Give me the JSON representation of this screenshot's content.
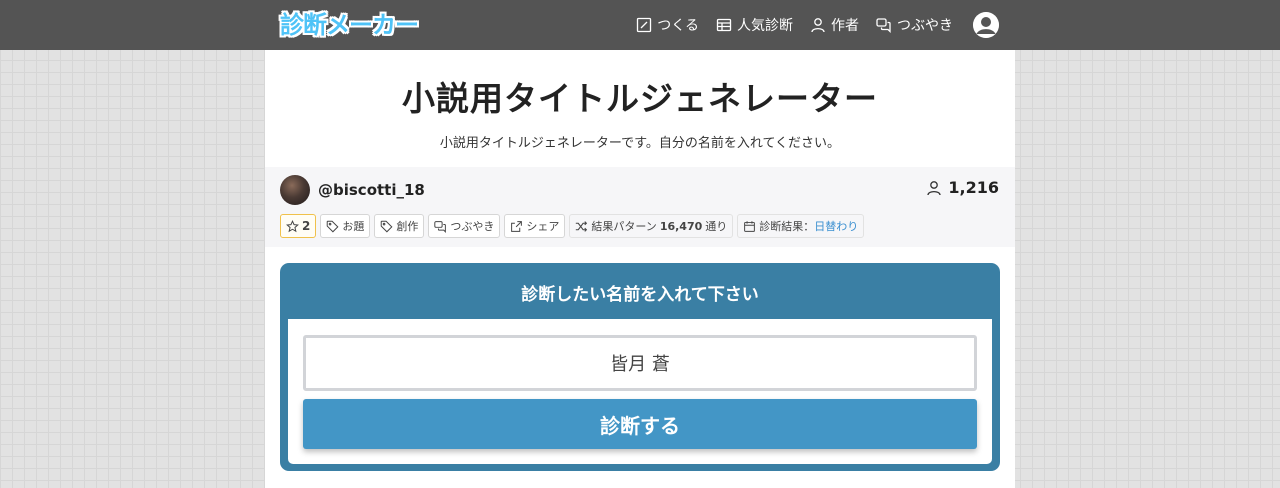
{
  "navbar": {
    "logo": "診断メーカー",
    "items": [
      {
        "icon": "edit-icon",
        "label": "つくる"
      },
      {
        "icon": "table-icon",
        "label": "人気診断"
      },
      {
        "icon": "user-icon",
        "label": "作者"
      },
      {
        "icon": "chat-icon",
        "label": "つぶやき"
      }
    ]
  },
  "page": {
    "title": "小説用タイトルジェネレーター",
    "description": "小説用タイトルジェネレーターです。自分の名前を入れてください。"
  },
  "author": {
    "name": "@biscotti_18",
    "count": "1,216"
  },
  "tags": {
    "fav_count": "2",
    "odai": "お題",
    "sousaku": "創作",
    "tsubuyaki": "つぶやき",
    "share": "シェア",
    "patterns_prefix": "結果パターン",
    "patterns_value": "16,470",
    "patterns_suffix": "通り",
    "result_prefix": "診断結果：",
    "result_value": "日替わり"
  },
  "form": {
    "heading": "診断したい名前を入れて下さい",
    "name_value": "皆月 蒼",
    "submit_label": "診断する"
  },
  "colors": {
    "navbar": "#545454",
    "form_frame": "#3a7fa4",
    "submit": "#4396c6",
    "logo": "#4fc3f7",
    "link": "#3a8fd0"
  }
}
